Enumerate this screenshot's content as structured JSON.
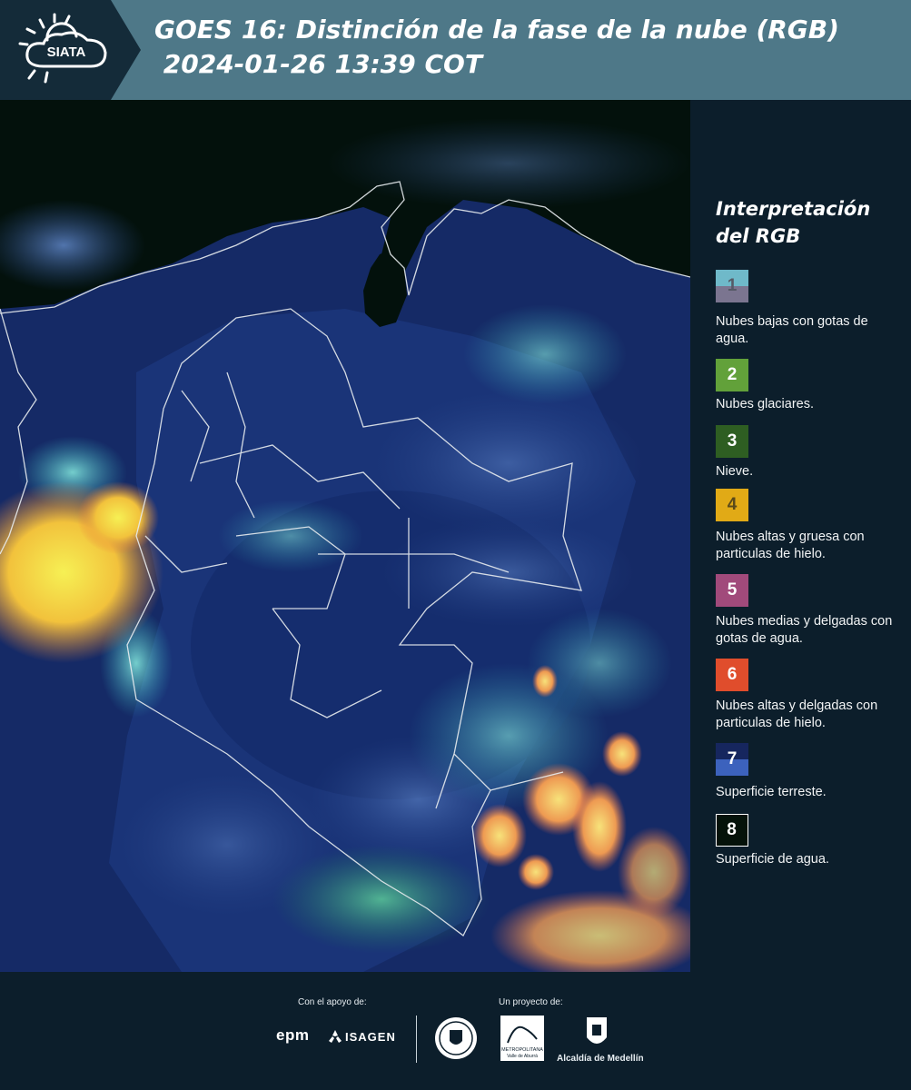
{
  "header": {
    "logo_text": "SIATA",
    "title_line1": "GOES 16: Distinción de la fase de la nube (RGB)",
    "title_line2": " 2024-01-26 13:39 COT"
  },
  "legend": {
    "heading_line1": "Interpretación",
    "heading_line2": "del RGB",
    "items": [
      {
        "num": "1",
        "label": "Nubes bajas con gotas de agua.",
        "color_top": "#6fb9c9",
        "color_bottom": "#7b7590"
      },
      {
        "num": "2",
        "label": "Nubes glaciares.",
        "color": "#62a13a"
      },
      {
        "num": "3",
        "label": "Nieve.",
        "color": "#2e5e22"
      },
      {
        "num": "4",
        "label": "Nubes altas y gruesa con particulas de hielo.",
        "color": "#e1aa16"
      },
      {
        "num": "5",
        "label": "Nubes medias y delgadas con gotas de agua.",
        "color": "#a14a7b"
      },
      {
        "num": "6",
        "label": "Nubes altas y delgadas con particulas de hielo.",
        "color": "#e04d2c"
      },
      {
        "num": "7",
        "label": "Superficie terreste.",
        "color_top": "#16265e",
        "color_bottom": "#3c62bd"
      },
      {
        "num": "8",
        "label": "Superficie de agua.",
        "color": "#05120a"
      }
    ]
  },
  "footer": {
    "support_label": "Con el apoyo de:",
    "project_label": "Un proyecto de:",
    "sponsor1": "epm",
    "sponsor2": "ISAGEN",
    "partner1_line1": "METROPOLITANA",
    "partner1_line2": "Valle de Aburrá",
    "partner2": "Alcaldía de Medellín"
  }
}
